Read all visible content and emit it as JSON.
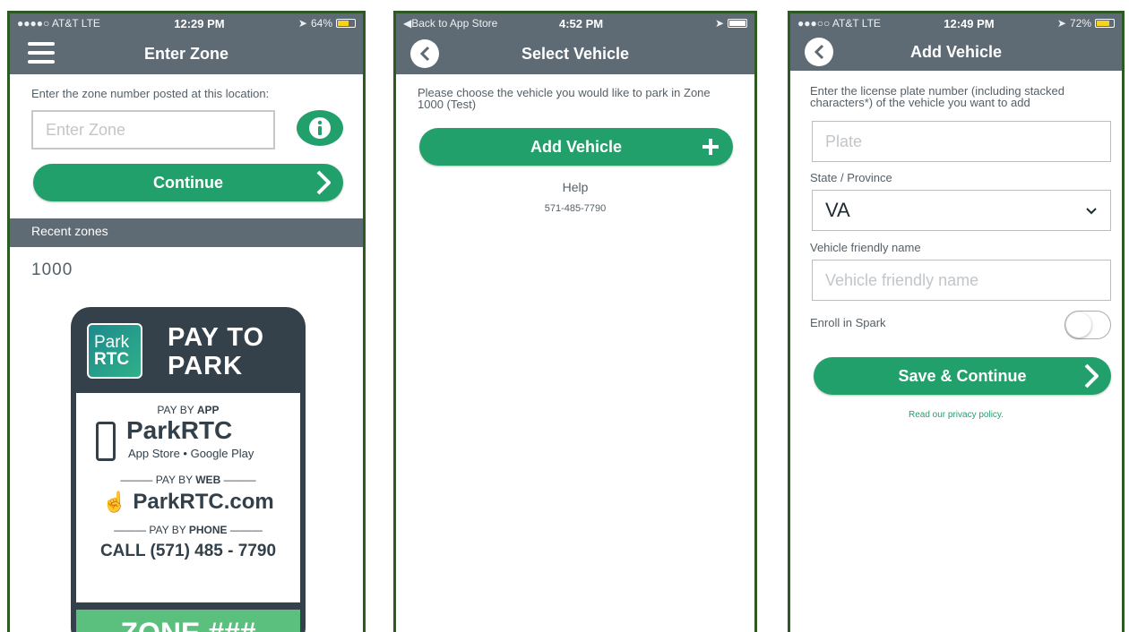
{
  "screen1": {
    "status": {
      "carrier": "●●●●○ AT&T  LTE",
      "time": "12:29 PM",
      "battery": "64%"
    },
    "title": "Enter Zone",
    "prompt": "Enter the zone number posted at this location:",
    "zone_placeholder": "Enter Zone",
    "continue_label": "Continue",
    "recent_header": "Recent zones",
    "recent_zones": [
      "1000"
    ],
    "sign": {
      "logo_line1": "Park",
      "logo_line2": "RTC",
      "heading_line1": "PAY TO",
      "heading_line2": "PARK",
      "pay_by_app_prefix": "PAY BY ",
      "pay_by_app_bold": "APP",
      "app_name": "ParkRTC",
      "stores": "App Store • Google Play",
      "pay_by_web_prefix": "PAY BY ",
      "pay_by_web_bold": "WEB",
      "web_name": "ParkRTC.com",
      "pay_by_phone_prefix": "PAY BY ",
      "pay_by_phone_bold": "PHONE",
      "phone_call": "CALL (571) 485 - 7790",
      "zone": "ZONE ###"
    }
  },
  "screen2": {
    "status": {
      "back_to": "◀Back to App Store",
      "time": "4:52 PM"
    },
    "title": "Select Vehicle",
    "instruction": "Please choose the vehicle you would like to park in Zone 1000 (Test)",
    "add_vehicle_label": "Add Vehicle",
    "help_label": "Help",
    "help_phone": "571-485-7790"
  },
  "screen3": {
    "status": {
      "carrier": "●●●○○ AT&T  LTE",
      "time": "12:49 PM",
      "battery": "72%"
    },
    "title": "Add Vehicle",
    "instruction": "Enter the license plate number (including stacked characters*) of the vehicle you want to add",
    "plate_placeholder": "Plate",
    "state_label": "State / Province",
    "state_value": "VA",
    "friendly_label": "Vehicle friendly name",
    "friendly_placeholder": "Vehicle friendly name",
    "enroll_label": "Enroll in Spark",
    "enroll_on": false,
    "save_label": "Save & Continue",
    "privacy_link": "Read our privacy policy."
  },
  "colors": {
    "header": "#5f6b74",
    "accent_green": "#22a06b",
    "frame": "#2c5a22"
  }
}
